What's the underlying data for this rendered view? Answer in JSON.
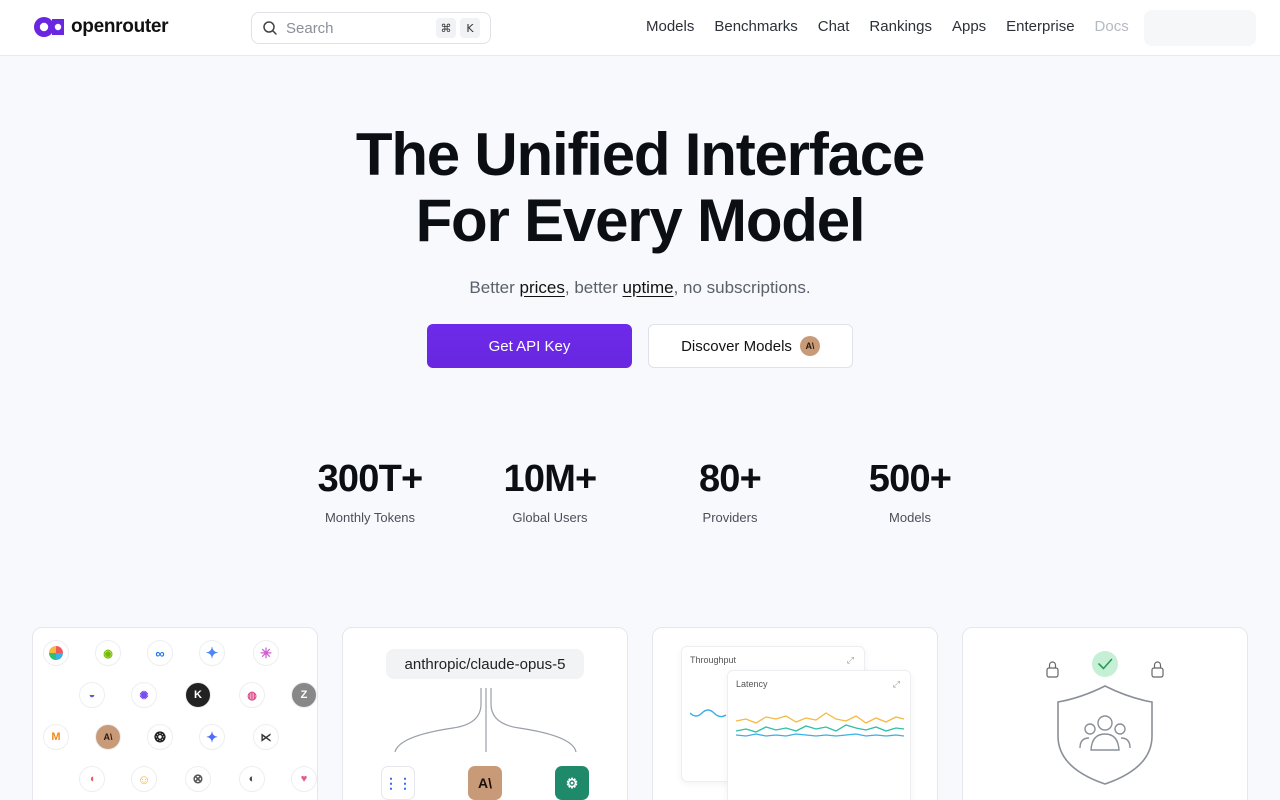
{
  "brand": {
    "name": "openrouter",
    "accent": "#6a26e0"
  },
  "search": {
    "placeholder": "Search",
    "kbd1": "⌘",
    "kbd2": "K"
  },
  "nav": [
    "Models",
    "Benchmarks",
    "Chat",
    "Rankings",
    "Apps",
    "Enterprise",
    "Docs"
  ],
  "hero": {
    "title_line1": "The Unified Interface",
    "title_line2": "For Every Model",
    "sub_pre": "Better",
    "sub_link1": "prices",
    "sub_mid": ", better",
    "sub_link2": "uptime",
    "sub_post": ", no subscriptions.",
    "primary_cta": "Get API Key",
    "secondary_cta": "Discover Models"
  },
  "stats": [
    {
      "value": "300T+",
      "label": "Monthly Tokens"
    },
    {
      "value": "10M+",
      "label": "Global Users"
    },
    {
      "value": "80+",
      "label": "Providers"
    },
    {
      "value": "500+",
      "label": "Models"
    }
  ],
  "cards": {
    "routing_model": "anthropic/claude-opus-5",
    "chart1_label": "Throughput",
    "chart2_label": "Latency",
    "series_colors": [
      "#f5b942",
      "#3ab0e8",
      "#2fbfa5"
    ]
  }
}
